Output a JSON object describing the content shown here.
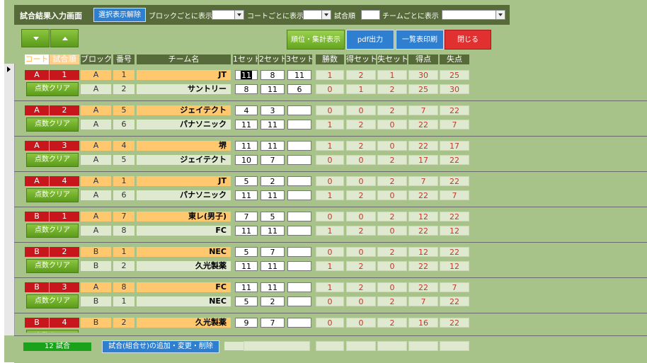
{
  "header": {
    "title": "試合結果入力画面",
    "clear_selection_label": "選択表示解除",
    "block_label": "ブロックごとに表示",
    "court_label": "コートごとに表示",
    "match_order_label": "試合順",
    "team_label": "チームごとに表示"
  },
  "actions": {
    "rank_label": "順位・集計表示",
    "pdf_label": "pdf出力",
    "print_label": "一覧表印刷",
    "close_label": "閉じる"
  },
  "columns": {
    "court": "コート",
    "order": "試合順",
    "block": "ブロック",
    "number": "番号",
    "team": "チーム名",
    "set1": "1セット",
    "set2": "2セット",
    "set3": "3セット",
    "wins": "勝数",
    "sets_won": "得セット",
    "sets_lost": "失セット",
    "points": "得点",
    "conceded": "失点"
  },
  "clear_label": "点数クリア",
  "matches": [
    {
      "court": "A",
      "order": "1",
      "t1": {
        "block": "A",
        "num": "1",
        "team": "JT",
        "s1": "11",
        "s2": "8",
        "s3": "11",
        "w": "1",
        "sw": "2",
        "sl": "1",
        "pt": "30",
        "pl": "25"
      },
      "t2": {
        "block": "A",
        "num": "2",
        "team": "サントリー",
        "s1": "8",
        "s2": "11",
        "s3": "6",
        "w": "0",
        "sw": "1",
        "sl": "2",
        "pt": "25",
        "pl": "30"
      }
    },
    {
      "court": "A",
      "order": "2",
      "t1": {
        "block": "A",
        "num": "5",
        "team": "ジェイテクト",
        "s1": "4",
        "s2": "3",
        "s3": "",
        "w": "0",
        "sw": "0",
        "sl": "2",
        "pt": "7",
        "pl": "22"
      },
      "t2": {
        "block": "A",
        "num": "6",
        "team": "パナソニック",
        "s1": "11",
        "s2": "11",
        "s3": "",
        "w": "1",
        "sw": "2",
        "sl": "0",
        "pt": "22",
        "pl": "7"
      }
    },
    {
      "court": "A",
      "order": "3",
      "t1": {
        "block": "A",
        "num": "4",
        "team": "堺",
        "s1": "11",
        "s2": "11",
        "s3": "",
        "w": "1",
        "sw": "2",
        "sl": "0",
        "pt": "22",
        "pl": "17"
      },
      "t2": {
        "block": "A",
        "num": "5",
        "team": "ジェイテクト",
        "s1": "10",
        "s2": "7",
        "s3": "",
        "w": "0",
        "sw": "0",
        "sl": "2",
        "pt": "17",
        "pl": "22"
      }
    },
    {
      "court": "A",
      "order": "4",
      "t1": {
        "block": "A",
        "num": "1",
        "team": "JT",
        "s1": "5",
        "s2": "2",
        "s3": "",
        "w": "0",
        "sw": "0",
        "sl": "2",
        "pt": "7",
        "pl": "22"
      },
      "t2": {
        "block": "A",
        "num": "6",
        "team": "パナソニック",
        "s1": "11",
        "s2": "11",
        "s3": "",
        "w": "1",
        "sw": "2",
        "sl": "0",
        "pt": "22",
        "pl": "7"
      }
    },
    {
      "court": "B",
      "order": "1",
      "t1": {
        "block": "A",
        "num": "7",
        "team": "東レ(男子)",
        "s1": "7",
        "s2": "5",
        "s3": "",
        "w": "0",
        "sw": "0",
        "sl": "2",
        "pt": "12",
        "pl": "22"
      },
      "t2": {
        "block": "A",
        "num": "8",
        "team": "FC",
        "s1": "11",
        "s2": "11",
        "s3": "",
        "w": "1",
        "sw": "2",
        "sl": "0",
        "pt": "22",
        "pl": "12"
      }
    },
    {
      "court": "B",
      "order": "2",
      "t1": {
        "block": "B",
        "num": "1",
        "team": "NEC",
        "s1": "5",
        "s2": "7",
        "s3": "",
        "w": "0",
        "sw": "0",
        "sl": "2",
        "pt": "12",
        "pl": "22"
      },
      "t2": {
        "block": "B",
        "num": "2",
        "team": "久光製薬",
        "s1": "11",
        "s2": "11",
        "s3": "",
        "w": "1",
        "sw": "2",
        "sl": "0",
        "pt": "22",
        "pl": "12"
      }
    },
    {
      "court": "B",
      "order": "3",
      "t1": {
        "block": "A",
        "num": "8",
        "team": "FC",
        "s1": "11",
        "s2": "11",
        "s3": "",
        "w": "1",
        "sw": "2",
        "sl": "0",
        "pt": "22",
        "pl": "7"
      },
      "t2": {
        "block": "B",
        "num": "1",
        "team": "NEC",
        "s1": "5",
        "s2": "2",
        "s3": "",
        "w": "0",
        "sw": "0",
        "sl": "2",
        "pt": "7",
        "pl": "22"
      }
    },
    {
      "court": "B",
      "order": "4",
      "t1": {
        "block": "B",
        "num": "2",
        "team": "久光製薬",
        "s1": "9",
        "s2": "7",
        "s3": "",
        "w": "0",
        "sw": "0",
        "sl": "2",
        "pt": "16",
        "pl": "22"
      },
      "t2": null
    }
  ],
  "footer": {
    "count_label": "12 試合",
    "edit_label": "試合(組合せ)の追加・変更・削除"
  },
  "colors": {
    "header_bg": "#576a3a",
    "body_bg": "#a8c38a",
    "court_red": "#c8161d",
    "team_orange": "#ffc76e",
    "blue_button": "#2f7fd0",
    "red_button": "#e03030",
    "green_button": "#6fae2a"
  }
}
